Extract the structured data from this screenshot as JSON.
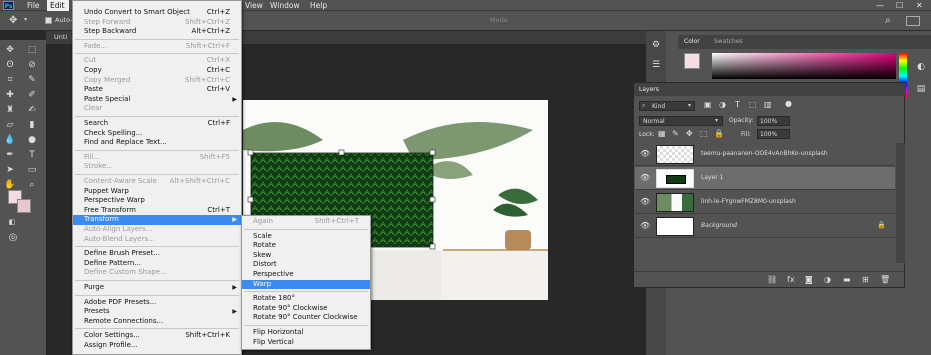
{
  "app": {
    "logo": "Ps"
  },
  "menubar": {
    "items": [
      "File",
      "Edit",
      "View",
      "Window",
      "Help"
    ]
  },
  "options_bar": {
    "auto_select": "Auto-",
    "show_transform": "Mode"
  },
  "doc_tab": {
    "title": "Unti"
  },
  "edit_menu": {
    "items": [
      {
        "label": "Undo Convert to Smart Object",
        "shortcut": "Ctrl+Z",
        "disabled": false
      },
      {
        "label": "Step Forward",
        "shortcut": "Shift+Ctrl+Z",
        "disabled": true
      },
      {
        "label": "Step Backward",
        "shortcut": "Alt+Ctrl+Z",
        "disabled": false
      },
      {
        "sep": true
      },
      {
        "label": "Fade...",
        "shortcut": "Shift+Ctrl+F",
        "disabled": true
      },
      {
        "sep": true
      },
      {
        "label": "Cut",
        "shortcut": "Ctrl+X",
        "disabled": true
      },
      {
        "label": "Copy",
        "shortcut": "Ctrl+C",
        "disabled": false
      },
      {
        "label": "Copy Merged",
        "shortcut": "Shift+Ctrl+C",
        "disabled": true
      },
      {
        "label": "Paste",
        "shortcut": "Ctrl+V",
        "disabled": false
      },
      {
        "label": "Paste Special",
        "shortcut": "",
        "disabled": false,
        "submenu": true
      },
      {
        "label": "Clear",
        "shortcut": "",
        "disabled": true
      },
      {
        "sep": true
      },
      {
        "label": "Search",
        "shortcut": "Ctrl+F",
        "disabled": false
      },
      {
        "label": "Check Spelling...",
        "shortcut": "",
        "disabled": false
      },
      {
        "label": "Find and Replace Text...",
        "shortcut": "",
        "disabled": false
      },
      {
        "sep": true
      },
      {
        "label": "Fill...",
        "shortcut": "Shift+F5",
        "disabled": true
      },
      {
        "label": "Stroke...",
        "shortcut": "",
        "disabled": true
      },
      {
        "sep": true
      },
      {
        "label": "Content-Aware Scale",
        "shortcut": "Alt+Shift+Ctrl+C",
        "disabled": true
      },
      {
        "label": "Puppet Warp",
        "shortcut": "",
        "disabled": false
      },
      {
        "label": "Perspective Warp",
        "shortcut": "",
        "disabled": false
      },
      {
        "label": "Free Transform",
        "shortcut": "Ctrl+T",
        "disabled": false
      },
      {
        "label": "Transform",
        "shortcut": "",
        "disabled": false,
        "submenu": true,
        "highlighted": true
      },
      {
        "label": "Auto-Align Layers...",
        "shortcut": "",
        "disabled": true
      },
      {
        "label": "Auto-Blend Layers...",
        "shortcut": "",
        "disabled": true
      },
      {
        "sep": true
      },
      {
        "label": "Define Brush Preset...",
        "shortcut": "",
        "disabled": false
      },
      {
        "label": "Define Pattern...",
        "shortcut": "",
        "disabled": false
      },
      {
        "label": "Define Custom Shape...",
        "shortcut": "",
        "disabled": true
      },
      {
        "sep": true
      },
      {
        "label": "Purge",
        "shortcut": "",
        "disabled": false,
        "submenu": true
      },
      {
        "sep": true
      },
      {
        "label": "Adobe PDF Presets...",
        "shortcut": "",
        "disabled": false
      },
      {
        "label": "Presets",
        "shortcut": "",
        "disabled": false,
        "submenu": true
      },
      {
        "label": "Remote Connections...",
        "shortcut": "",
        "disabled": false
      },
      {
        "sep": true
      },
      {
        "label": "Color Settings...",
        "shortcut": "Shift+Ctrl+K",
        "disabled": false
      },
      {
        "label": "Assign Profile...",
        "shortcut": "",
        "disabled": false
      }
    ]
  },
  "transform_menu": {
    "items": [
      {
        "label": "Again",
        "shortcut": "Shift+Ctrl+T",
        "disabled": true
      },
      {
        "sep": true
      },
      {
        "label": "Scale",
        "shortcut": "",
        "disabled": false
      },
      {
        "label": "Rotate",
        "shortcut": "",
        "disabled": false
      },
      {
        "label": "Skew",
        "shortcut": "",
        "disabled": false
      },
      {
        "label": "Distort",
        "shortcut": "",
        "disabled": false
      },
      {
        "label": "Perspective",
        "shortcut": "",
        "disabled": false
      },
      {
        "label": "Warp",
        "shortcut": "",
        "disabled": false,
        "highlighted": true
      },
      {
        "sep": true
      },
      {
        "label": "Rotate 180°",
        "shortcut": "",
        "disabled": false
      },
      {
        "label": "Rotate 90° Clockwise",
        "shortcut": "",
        "disabled": false
      },
      {
        "label": "Rotate 90° Counter Clockwise",
        "shortcut": "",
        "disabled": false
      },
      {
        "sep": true
      },
      {
        "label": "Flip Horizontal",
        "shortcut": "",
        "disabled": false
      },
      {
        "label": "Flip Vertical",
        "shortcut": "",
        "disabled": false
      }
    ]
  },
  "color_panel": {
    "tab1": "Color",
    "tab2": "Swatches"
  },
  "layers_panel": {
    "title": "Layers",
    "filter_kind": "Kind",
    "blend_mode": "Normal",
    "opacity_label": "Opacity:",
    "opacity_value": "100%",
    "lock_label": "Lock:",
    "fill_label": "Fill:",
    "fill_value": "100%",
    "layers": [
      {
        "name": "teemu-paananen-OOE4vAnBhKo-unsplash",
        "selected": false
      },
      {
        "name": "Layer 1",
        "selected": true
      },
      {
        "name": "linh-le-FYgnwFMZ8M0-unsplash",
        "selected": false
      },
      {
        "name": "Background",
        "selected": false
      }
    ]
  },
  "colors": {
    "menu_highlight": "#3c8cf0",
    "panel_bg": "#535353",
    "canvas_bg": "#282828",
    "selected_layer": "#6d6d6d"
  }
}
